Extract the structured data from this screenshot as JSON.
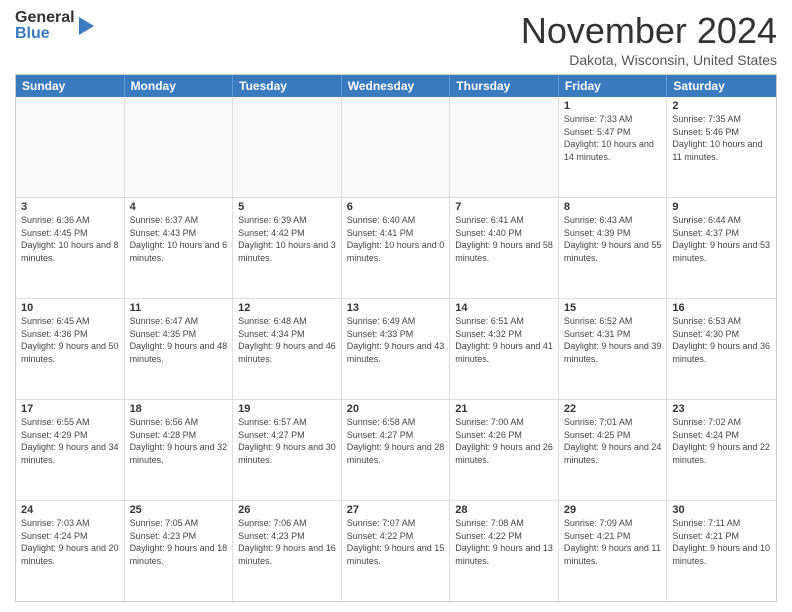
{
  "logo": {
    "general": "General",
    "blue": "Blue"
  },
  "title": "November 2024",
  "location": "Dakota, Wisconsin, United States",
  "days_of_week": [
    "Sunday",
    "Monday",
    "Tuesday",
    "Wednesday",
    "Thursday",
    "Friday",
    "Saturday"
  ],
  "weeks": [
    [
      {
        "day": "",
        "info": ""
      },
      {
        "day": "",
        "info": ""
      },
      {
        "day": "",
        "info": ""
      },
      {
        "day": "",
        "info": ""
      },
      {
        "day": "",
        "info": ""
      },
      {
        "day": "1",
        "info": "Sunrise: 7:33 AM\nSunset: 5:47 PM\nDaylight: 10 hours and 14 minutes."
      },
      {
        "day": "2",
        "info": "Sunrise: 7:35 AM\nSunset: 5:46 PM\nDaylight: 10 hours and 11 minutes."
      }
    ],
    [
      {
        "day": "3",
        "info": "Sunrise: 6:36 AM\nSunset: 4:45 PM\nDaylight: 10 hours and 8 minutes."
      },
      {
        "day": "4",
        "info": "Sunrise: 6:37 AM\nSunset: 4:43 PM\nDaylight: 10 hours and 6 minutes."
      },
      {
        "day": "5",
        "info": "Sunrise: 6:39 AM\nSunset: 4:42 PM\nDaylight: 10 hours and 3 minutes."
      },
      {
        "day": "6",
        "info": "Sunrise: 6:40 AM\nSunset: 4:41 PM\nDaylight: 10 hours and 0 minutes."
      },
      {
        "day": "7",
        "info": "Sunrise: 6:41 AM\nSunset: 4:40 PM\nDaylight: 9 hours and 58 minutes."
      },
      {
        "day": "8",
        "info": "Sunrise: 6:43 AM\nSunset: 4:39 PM\nDaylight: 9 hours and 55 minutes."
      },
      {
        "day": "9",
        "info": "Sunrise: 6:44 AM\nSunset: 4:37 PM\nDaylight: 9 hours and 53 minutes."
      }
    ],
    [
      {
        "day": "10",
        "info": "Sunrise: 6:45 AM\nSunset: 4:36 PM\nDaylight: 9 hours and 50 minutes."
      },
      {
        "day": "11",
        "info": "Sunrise: 6:47 AM\nSunset: 4:35 PM\nDaylight: 9 hours and 48 minutes."
      },
      {
        "day": "12",
        "info": "Sunrise: 6:48 AM\nSunset: 4:34 PM\nDaylight: 9 hours and 46 minutes."
      },
      {
        "day": "13",
        "info": "Sunrise: 6:49 AM\nSunset: 4:33 PM\nDaylight: 9 hours and 43 minutes."
      },
      {
        "day": "14",
        "info": "Sunrise: 6:51 AM\nSunset: 4:32 PM\nDaylight: 9 hours and 41 minutes."
      },
      {
        "day": "15",
        "info": "Sunrise: 6:52 AM\nSunset: 4:31 PM\nDaylight: 9 hours and 39 minutes."
      },
      {
        "day": "16",
        "info": "Sunrise: 6:53 AM\nSunset: 4:30 PM\nDaylight: 9 hours and 36 minutes."
      }
    ],
    [
      {
        "day": "17",
        "info": "Sunrise: 6:55 AM\nSunset: 4:29 PM\nDaylight: 9 hours and 34 minutes."
      },
      {
        "day": "18",
        "info": "Sunrise: 6:56 AM\nSunset: 4:28 PM\nDaylight: 9 hours and 32 minutes."
      },
      {
        "day": "19",
        "info": "Sunrise: 6:57 AM\nSunset: 4:27 PM\nDaylight: 9 hours and 30 minutes."
      },
      {
        "day": "20",
        "info": "Sunrise: 6:58 AM\nSunset: 4:27 PM\nDaylight: 9 hours and 28 minutes."
      },
      {
        "day": "21",
        "info": "Sunrise: 7:00 AM\nSunset: 4:26 PM\nDaylight: 9 hours and 26 minutes."
      },
      {
        "day": "22",
        "info": "Sunrise: 7:01 AM\nSunset: 4:25 PM\nDaylight: 9 hours and 24 minutes."
      },
      {
        "day": "23",
        "info": "Sunrise: 7:02 AM\nSunset: 4:24 PM\nDaylight: 9 hours and 22 minutes."
      }
    ],
    [
      {
        "day": "24",
        "info": "Sunrise: 7:03 AM\nSunset: 4:24 PM\nDaylight: 9 hours and 20 minutes."
      },
      {
        "day": "25",
        "info": "Sunrise: 7:05 AM\nSunset: 4:23 PM\nDaylight: 9 hours and 18 minutes."
      },
      {
        "day": "26",
        "info": "Sunrise: 7:06 AM\nSunset: 4:23 PM\nDaylight: 9 hours and 16 minutes."
      },
      {
        "day": "27",
        "info": "Sunrise: 7:07 AM\nSunset: 4:22 PM\nDaylight: 9 hours and 15 minutes."
      },
      {
        "day": "28",
        "info": "Sunrise: 7:08 AM\nSunset: 4:22 PM\nDaylight: 9 hours and 13 minutes."
      },
      {
        "day": "29",
        "info": "Sunrise: 7:09 AM\nSunset: 4:21 PM\nDaylight: 9 hours and 11 minutes."
      },
      {
        "day": "30",
        "info": "Sunrise: 7:11 AM\nSunset: 4:21 PM\nDaylight: 9 hours and 10 minutes."
      }
    ]
  ]
}
